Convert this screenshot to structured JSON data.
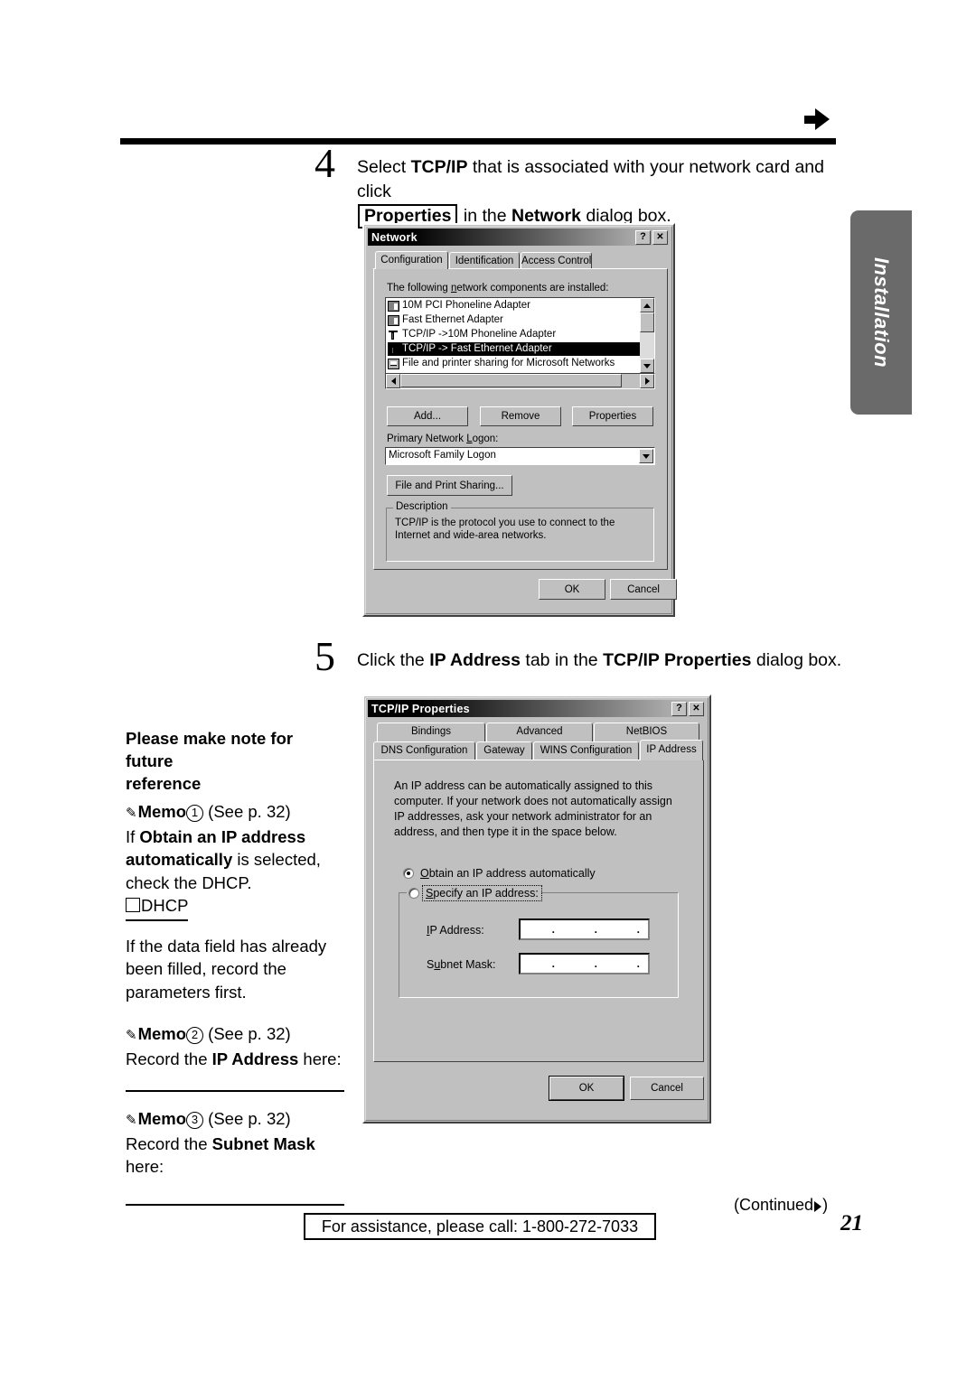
{
  "page": {
    "number": "21",
    "side_tab_label": "Installation",
    "continued_label": "(Continued",
    "continued_close": ")",
    "footer_text": "For assistance, please call: 1-800-272-7033"
  },
  "step4": {
    "number": "4",
    "line1_pre": "Select ",
    "line1_bold": "TCP/IP",
    "line1_post": " that is associated with your network card and click",
    "line2_button": "Properties",
    "line2_mid": " in the ",
    "line2_bold": "Network",
    "line2_post": " dialog box."
  },
  "step5": {
    "number": "5",
    "pre": "Click the ",
    "bold1": "IP Address",
    "mid": " tab in the ",
    "bold2": "TCP/IP Properties",
    "post": " dialog box."
  },
  "network_dialog": {
    "title": "Network",
    "help_button": "?",
    "close_button": "✕",
    "tabs": [
      {
        "label": "Configuration",
        "active": true
      },
      {
        "label": "Identification",
        "active": false
      },
      {
        "label": "Access Control",
        "active": false
      }
    ],
    "list_label": "The following network components are installed:",
    "components": [
      {
        "name": "10M PCI Phoneline Adapter",
        "icon": "network-card-icon",
        "selected": false
      },
      {
        "name": "Fast Ethernet Adapter",
        "icon": "network-card-icon",
        "selected": false
      },
      {
        "name": "TCP/IP ->10M Phoneline Adapter",
        "icon": "protocol-icon",
        "selected": false
      },
      {
        "name": "TCP/IP -> Fast Ethernet Adapter",
        "icon": "protocol-icon",
        "selected": true
      },
      {
        "name": "File and printer sharing for Microsoft Networks",
        "icon": "file-sharing-icon",
        "selected": false
      }
    ],
    "buttons": {
      "add": "Add...",
      "remove": "Remove",
      "properties": "Properties"
    },
    "logon_label": "Primary Network Logon:",
    "logon_value": "Microsoft Family Logon",
    "file_print_sharing": "File and Print Sharing...",
    "description_group": "Description",
    "description_text": "TCP/IP is the protocol you use to connect to the Internet and wide-area networks.",
    "ok": "OK",
    "cancel": "Cancel"
  },
  "tcpip_dialog": {
    "title": "TCP/IP Properties",
    "help_button": "?",
    "close_button": "✕",
    "tabs_row1": [
      {
        "label": "Bindings",
        "active": false
      },
      {
        "label": "Advanced",
        "active": false
      },
      {
        "label": "NetBIOS",
        "active": false
      }
    ],
    "tabs_row2": [
      {
        "label": "DNS Configuration",
        "active": false
      },
      {
        "label": "Gateway",
        "active": false
      },
      {
        "label": "WINS Configuration",
        "active": false
      },
      {
        "label": "IP Address",
        "active": true
      }
    ],
    "description": "An IP address can be automatically assigned to this computer. If your network does not automatically assign IP addresses, ask your network administrator for an address, and then type it in the space below.",
    "radio_auto": "Obtain an IP address automatically",
    "radio_auto_selected": true,
    "radio_specify": "Specify an IP address:",
    "radio_specify_selected": false,
    "ip_address_label": "IP Address:",
    "ip_address_value": [
      "",
      ".",
      ".",
      "."
    ],
    "subnet_mask_label": "Subnet Mask:",
    "subnet_mask_value": [
      "",
      ".",
      ".",
      "."
    ],
    "ok": "OK",
    "cancel": "Cancel"
  },
  "memo": {
    "heading_line1": "Please make note for future",
    "heading_line2": "reference",
    "memo1_label": "Memo",
    "memo1_num": "1",
    "memo1_see": "(See p. 32)",
    "memo1_line1_pre": "If ",
    "memo1_line1_bold": "Obtain an IP address",
    "memo1_line2_bold": "automatically",
    "memo1_line2_post": " is selected,",
    "memo1_line3": "check the DHCP.",
    "memo1_dhcp": "DHCP",
    "memo1_body2_line1": "If the data field has already",
    "memo1_body2_line2": "been filled, record the",
    "memo1_body2_line3": "parameters first.",
    "memo2_label": "Memo",
    "memo2_num": "2",
    "memo2_see": "(See p. 32)",
    "memo2_pre": "Record the ",
    "memo2_bold": "IP Address",
    "memo2_post": " here:",
    "memo3_label": "Memo",
    "memo3_num": "3",
    "memo3_see": "(See p. 32)",
    "memo3_pre": "Record the ",
    "memo3_bold": "Subnet Mask",
    "memo3_post": "",
    "memo3_line2": "here:"
  }
}
